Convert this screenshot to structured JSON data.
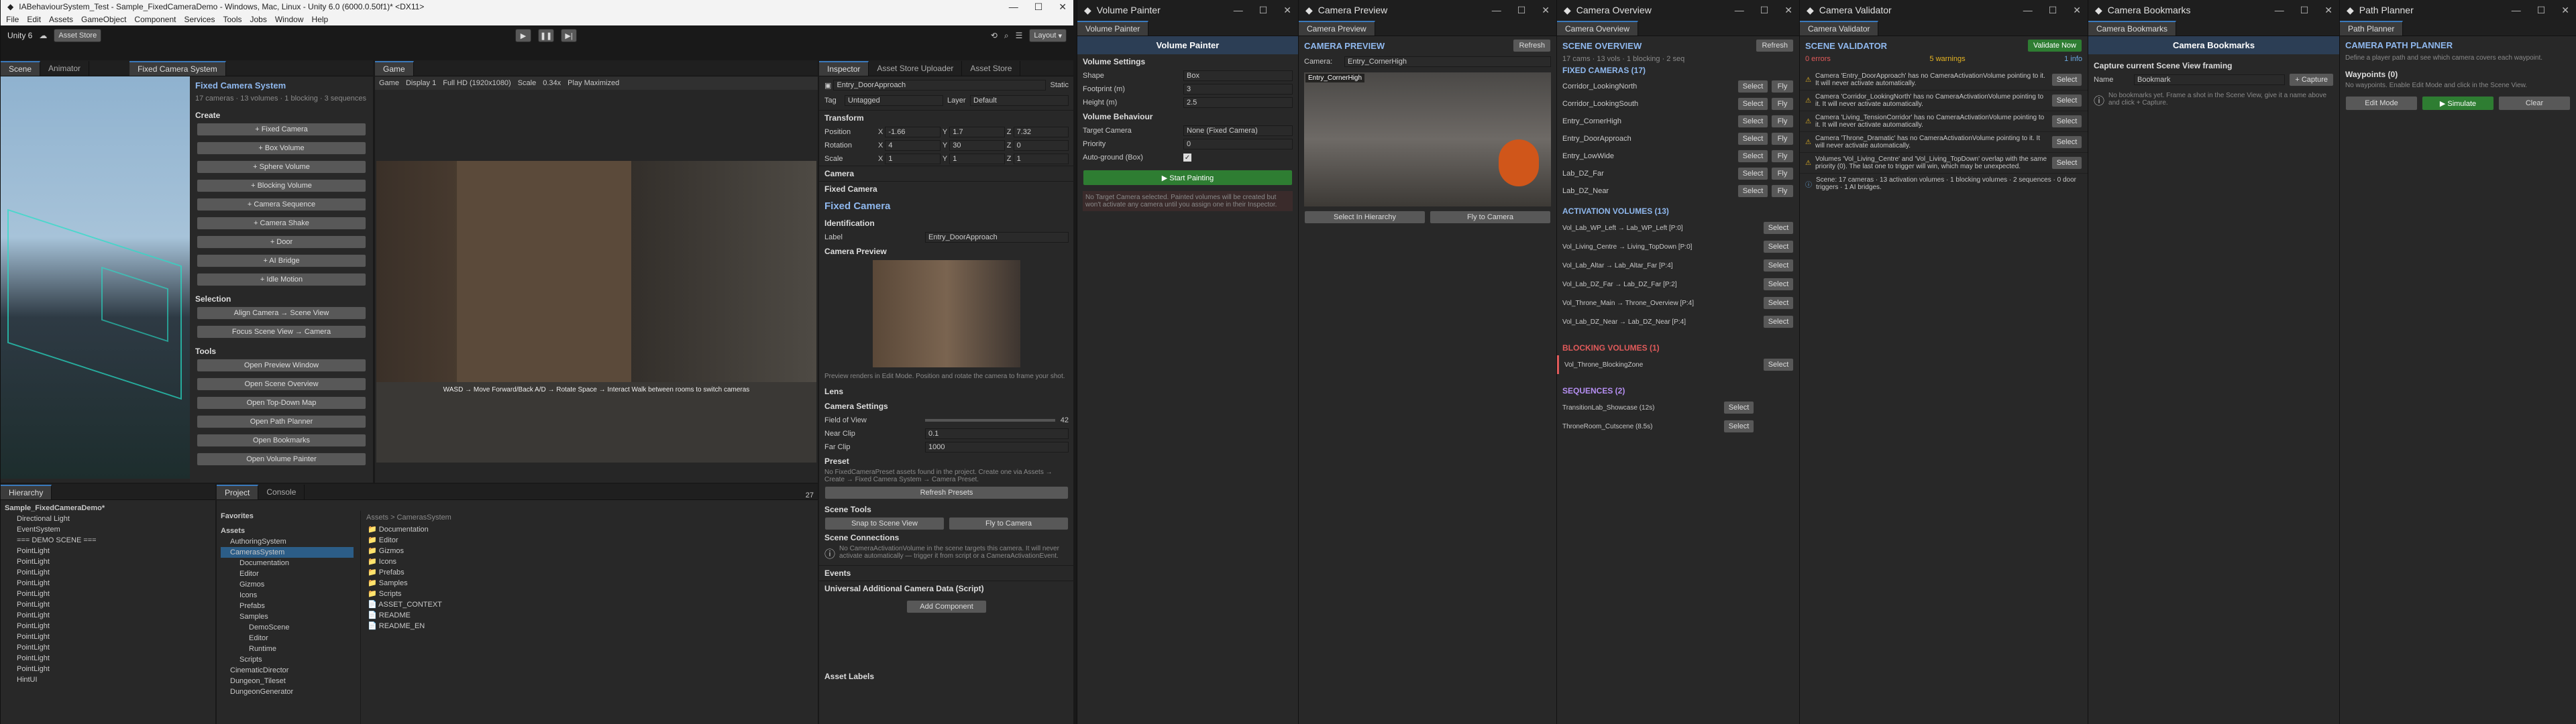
{
  "unity": {
    "title": "IABehaviourSystem_Test - Sample_FixedCameraDemo - Windows, Mac, Linux - Unity 6.0 (6000.0.50f1)* <DX11>",
    "menu": [
      "File",
      "Edit",
      "Assets",
      "GameObject",
      "Component",
      "Services",
      "Tools",
      "Jobs",
      "Window",
      "Help"
    ],
    "account": "Unity 6",
    "asset_store": "Asset Store",
    "layout": "Layout",
    "scene_tabs": [
      "Scene",
      "Animator"
    ],
    "fcs_tab": "Fixed Camera System",
    "fcs": {
      "title": "Fixed Camera System",
      "stats": "17 cameras · 13 volumes · 1 blocking · 3 sequences",
      "create_h": "Create",
      "create": [
        "+ Fixed Camera",
        "+ Box Volume",
        "+ Sphere Volume",
        "+ Blocking Volume",
        "+ Camera Sequence",
        "+ Camera Shake",
        "+ Door",
        "+ AI Bridge",
        "+ Idle Motion"
      ],
      "selection_h": "Selection",
      "selection": [
        "Align Camera → Scene View",
        "Focus Scene View → Camera"
      ],
      "tools_h": "Tools",
      "tools": [
        "Open Preview Window",
        "Open Scene Overview",
        "Open Top-Down Map",
        "Open Path Planner",
        "Open Bookmarks",
        "Open Volume Painter"
      ]
    },
    "game": {
      "tab": "Game",
      "mode": "Game",
      "display": "Display 1",
      "res": "Full HD (1920x1080)",
      "scale": "Scale",
      "scale_val": "0.34x",
      "play": "Play Maximized",
      "overlay": "WASD → Move Forward/Back   A/D → Rotate   Space → Interact   Walk between rooms to switch cameras"
    },
    "inspector": {
      "tabs": [
        "Inspector",
        "Asset Store Uploader",
        "Asset Store"
      ],
      "object": "Entry_DoorApproach",
      "static": "Static",
      "tag_l": "Tag",
      "tag": "Untagged",
      "layer_l": "Layer",
      "layer": "Default",
      "transform": "Transform",
      "pos_l": "Position",
      "pos": [
        "-1.66",
        "1.7",
        "7.32"
      ],
      "rot_l": "Rotation",
      "rot": [
        "4",
        "30",
        "0"
      ],
      "scale_l": "Scale",
      "scale": [
        "1",
        "1",
        "1"
      ],
      "camera": "Camera",
      "fixed_camera": "Fixed Camera",
      "fc_title": "Fixed Camera",
      "ident_h": "Identification",
      "label_l": "Label",
      "label": "Entry_DoorApproach",
      "preview_h": "Camera Preview",
      "preview_note": "Preview renders in Edit Mode. Position and rotate the camera to frame your shot.",
      "lens_h": "Lens",
      "settings_h": "Camera Settings",
      "fov_l": "Field of View",
      "fov": "42",
      "near_l": "Near Clip",
      "near": "0.1",
      "far_l": "Far Clip",
      "far": "1000",
      "preset_h": "Preset",
      "preset_note": "No FixedCameraPreset assets found in the project. Create one via Assets → Create → Fixed Camera System → Camera Preset.",
      "refresh_presets": "Refresh Presets",
      "tools_h": "Scene Tools",
      "snap": "Snap to Scene View",
      "fly": "Fly to Camera",
      "conn_h": "Scene Connections",
      "conn_note": "No CameraActivationVolume in the scene targets this camera. It will never activate automatically — trigger it from script or a CameraActivationEvent.",
      "events": "Events",
      "uacd": "Universal Additional Camera Data (Script)",
      "add_comp": "Add Component",
      "asset_labels": "Asset Labels"
    },
    "hierarchy": {
      "tab": "Hierarchy",
      "root": "Sample_FixedCameraDemo*",
      "items": [
        "Directional Light",
        "EventSystem",
        "=== DEMO SCENE ===",
        "PointLight",
        "PointLight",
        "PointLight",
        "PointLight",
        "PointLight",
        "PointLight",
        "PointLight",
        "PointLight",
        "PointLight",
        "PointLight",
        "PointLight",
        "PointLight",
        "HintUI"
      ]
    },
    "project": {
      "tabs": [
        "Project",
        "Console"
      ],
      "fav": "Favorites",
      "assets": "Assets",
      "tree": [
        "AuthoringSystem",
        "CamerasSystem",
        "Documentation",
        "Editor",
        "Gizmos",
        "Icons",
        "Prefabs",
        "Samples",
        "DemoScene",
        "Editor",
        "Runtime",
        "Scripts",
        "CinematicDirector",
        "Dungeon_Tileset",
        "DungeonGenerator"
      ],
      "path": "Assets > CamerasSystem",
      "files": [
        "Documentation",
        "Editor",
        "Gizmos",
        "Icons",
        "Prefabs",
        "Samples",
        "Scripts",
        "ASSET_CONTEXT",
        "README",
        "README_EN"
      ],
      "count": "27"
    }
  },
  "volume_painter": {
    "win_title": "Volume Painter",
    "tab": "Volume Painter",
    "title": "Volume Painter",
    "settings_h": "Volume Settings",
    "shape_l": "Shape",
    "shape": "Box",
    "footprint_l": "Footprint (m)",
    "footprint": "3",
    "height_l": "Height (m)",
    "height": "2.5",
    "behaviour_h": "Volume Behaviour",
    "target_l": "Target Camera",
    "target": "None (Fixed Camera)",
    "priority_l": "Priority",
    "priority": "0",
    "auto_l": "Auto-ground (Box)",
    "start": "▶ Start Painting",
    "note": "No Target Camera selected. Painted volumes will be created but won't activate any camera until you assign one in their Inspector."
  },
  "camera_preview": {
    "win_title": "Camera Preview",
    "tab": "Camera Preview",
    "title": "CAMERA PREVIEW",
    "refresh": "Refresh",
    "camera_l": "Camera:",
    "camera": "Entry_CornerHigh",
    "view_label": "Entry_CornerHigh",
    "select_btn": "Select In Hierarchy",
    "fly_btn": "Fly to Camera"
  },
  "camera_overview": {
    "win_title": "Camera Overview",
    "tab": "Camera Overview",
    "title": "SCENE OVERVIEW",
    "refresh": "Refresh",
    "stats": "17 cams · 13 vols · 1 blocking · 2 seq",
    "fixed_h": "FIXED CAMERAS (17)",
    "cams": [
      "Corridor_LookingNorth",
      "Corridor_LookingSouth",
      "Entry_CornerHigh",
      "Entry_DoorApproach",
      "Entry_LowWide",
      "Lab_DZ_Far",
      "Lab_DZ_Near"
    ],
    "vol_h": "ACTIVATION VOLUMES (13)",
    "vols": [
      "Vol_Lab_WP_Left → Lab_WP_Left [P:0]",
      "Vol_Living_Centre → Living_TopDown [P:0]",
      "Vol_Lab_Altar → Lab_Altar_Far [P:4]",
      "Vol_Lab_DZ_Far → Lab_DZ_Far [P:2]",
      "Vol_Throne_Main → Throne_Overview [P:4]",
      "Vol_Lab_DZ_Near → Lab_DZ_Near [P:4]"
    ],
    "block_h": "BLOCKING VOLUMES (1)",
    "blocks": [
      "Vol_Throne_BlockingZone"
    ],
    "seq_h": "SEQUENCES (2)",
    "seqs": [
      "TransitionLab_Showcase (12s)",
      "ThroneRoom_Cutscene (8.5s)"
    ],
    "select": "Select",
    "fly": "Fly"
  },
  "camera_validator": {
    "win_title": "Camera Validator",
    "tab": "Camera Validator",
    "title": "SCENE VALIDATOR",
    "validate": "Validate Now",
    "errors": "0 errors",
    "warnings": "5 warnings",
    "infos": "1 info",
    "issues": [
      "Camera 'Entry_DoorApproach' has no CameraActivationVolume pointing to it. It will never activate automatically.",
      "Camera 'Corridor_LookingNorth' has no CameraActivationVolume pointing to it. It will never activate automatically.",
      "Camera 'Living_TensionCorridor' has no CameraActivationVolume pointing to it. It will never activate automatically.",
      "Camera 'Throne_Dramatic' has no CameraActivationVolume pointing to it. It will never activate automatically.",
      "Volumes 'Vol_Living_Centre' and 'Vol_Living_TopDown' overlap with the same priority (0). The last one to trigger will win, which may be unexpected."
    ],
    "info": "Scene: 17 cameras · 13 activation volumes · 1 blocking volumes · 2 sequences · 0 door triggers · 1 AI bridges.",
    "select": "Select"
  },
  "camera_bookmarks": {
    "win_title": "Camera Bookmarks",
    "tab": "Camera Bookmarks",
    "title": "Camera Bookmarks",
    "capture_h": "Capture current Scene View framing",
    "name_l": "Name",
    "name_val": "Bookmark",
    "capture": "+ Capture",
    "empty": "No bookmarks yet. Frame a shot in the Scene View, give it a name above and click + Capture."
  },
  "path_planner": {
    "win_title": "Path Planner",
    "tab": "Path Planner",
    "title": "CAMERA PATH PLANNER",
    "desc": "Define a player path and see which camera covers each waypoint.",
    "waypoints_h": "Waypoints (0)",
    "empty": "No waypoints. Enable Edit Mode and click in the Scene View.",
    "edit": "Edit Mode",
    "simulate": "▶ Simulate",
    "clear": "Clear"
  }
}
